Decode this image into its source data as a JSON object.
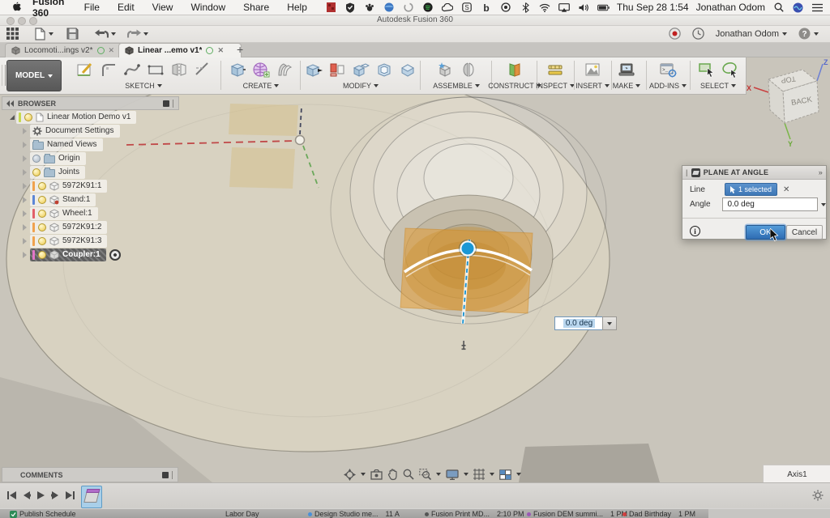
{
  "menubar": {
    "app_name": "Fusion 360",
    "menus": [
      "File",
      "Edit",
      "View",
      "Window",
      "Share",
      "Help"
    ],
    "clock": "Thu Sep 28 1:54",
    "user": "Jonathan Odom"
  },
  "titlebar": {
    "title": "Autodesk Fusion 360"
  },
  "quickbar": {
    "user": "Jonathan Odom"
  },
  "doc_tabs": {
    "tabs": [
      {
        "label": "Locomoti...ings v2*"
      },
      {
        "label": "Linear ...emo v1*"
      }
    ],
    "new_tab": "+"
  },
  "ribbon": {
    "workspace": "MODEL",
    "groups": [
      {
        "label": "SKETCH"
      },
      {
        "label": "CREATE"
      },
      {
        "label": "MODIFY"
      },
      {
        "label": "ASSEMBLE"
      },
      {
        "label": "CONSTRUCT"
      },
      {
        "label": "INSPECT"
      },
      {
        "label": "INSERT"
      },
      {
        "label": "MAKE"
      },
      {
        "label": "ADD-INS"
      },
      {
        "label": "SELECT"
      }
    ]
  },
  "viewcube": {
    "top": "TOP",
    "back": "BACK",
    "axis_x": "X",
    "axis_y": "Y",
    "axis_z": "Z"
  },
  "browser": {
    "title": "BROWSER",
    "items": [
      {
        "label": "Linear Motion Demo v1",
        "bar_color": "#c6d94e"
      },
      {
        "label": "Document Settings"
      },
      {
        "label": "Named Views"
      },
      {
        "label": "Origin"
      },
      {
        "label": "Joints"
      },
      {
        "label": "5972K91:1",
        "bar_color": "#f0a24e"
      },
      {
        "label": "Stand:1",
        "bar_color": "#5c86d6"
      },
      {
        "label": "Wheel:1",
        "bar_color": "#e2606a"
      },
      {
        "label": "5972K91:2",
        "bar_color": "#f0a24e"
      },
      {
        "label": "5972K91:3",
        "bar_color": "#f0a24e"
      },
      {
        "label": "Coupler:1",
        "bar_color": "#e276c8",
        "selected": true
      }
    ]
  },
  "dialog": {
    "title": "PLANE AT ANGLE",
    "line_label": "Line",
    "line_value": "1 selected",
    "angle_label": "Angle",
    "angle_value": "0.0 deg",
    "ok": "OK",
    "cancel": "Cancel"
  },
  "canvas": {
    "angle_input_value": "0.0 deg",
    "status_hint": "Axis1"
  },
  "comments": {
    "title": "COMMENTS"
  },
  "colors": {
    "accent_blue": "#1a97d5",
    "selection_chip_blue": "#3f78b6",
    "plane_orange": "#e29e3a",
    "canvas_background": "#c9c5bb",
    "timeline_selection": "#a9cfe9"
  },
  "background_window": {
    "events": [
      {
        "title": "Publish Schedule",
        "time": ""
      },
      {
        "title": "Labor Day",
        "time": ""
      },
      {
        "title": "Design Studio me...",
        "time": "11 A"
      },
      {
        "title": "Fusion Print MD...",
        "time": "2:10 PM"
      },
      {
        "title": "Fusion DEM summi...",
        "time": "1 PM"
      },
      {
        "title": "Dad Birthday",
        "time": "1 PM"
      }
    ]
  }
}
